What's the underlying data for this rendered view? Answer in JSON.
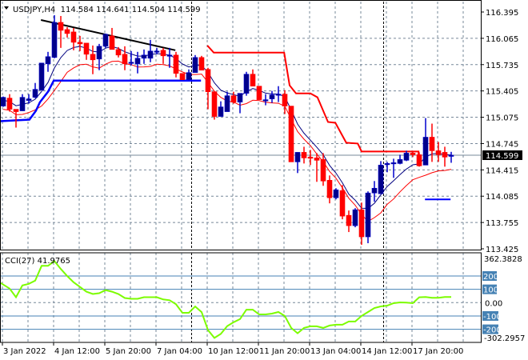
{
  "header": {
    "collapse_icon": "triangle-down-icon",
    "symbol_info": "USDJPY,H4  114.584 114.641 114.504 114.599"
  },
  "current_price": "114.599",
  "colors": {
    "bull": "#00008B",
    "bear": "#FF0000",
    "cci": "#7CFC00",
    "level": "#4682B4",
    "grid": "#778899"
  },
  "chart_data": {
    "type": "candlestick",
    "symbol": "USDJPY",
    "timeframe": "H4",
    "price_ticks": [
      "116.395",
      "116.065",
      "115.735",
      "115.405",
      "115.075",
      "114.745",
      "114.415",
      "114.085",
      "113.755",
      "113.425"
    ],
    "price_range": [
      113.425,
      116.395
    ],
    "time_labels": [
      {
        "label": "3 Jan 2022",
        "index": 0
      },
      {
        "label": "4 Jan 12:00",
        "index": 8
      },
      {
        "label": "5 Jan 20:00",
        "index": 16
      },
      {
        "label": "7 Jan 04:00",
        "index": 24
      },
      {
        "label": "10 Jan 12:00",
        "index": 32
      },
      {
        "label": "11 Jan 20:00",
        "index": 40
      },
      {
        "label": "13 Jan 04:00",
        "index": 48
      },
      {
        "label": "14 Jan 12:00",
        "index": 56
      },
      {
        "label": "17 Jan 20:00",
        "index": 64
      }
    ],
    "session_separators": [
      29,
      59
    ],
    "candles_ohlc": [
      [
        115.215,
        115.335,
        115.205,
        115.325
      ],
      [
        115.315,
        115.365,
        115.145,
        115.175
      ],
      [
        115.175,
        115.175,
        114.945,
        115.145
      ],
      [
        115.155,
        115.365,
        115.155,
        115.325
      ],
      [
        115.285,
        115.365,
        115.245,
        115.305
      ],
      [
        115.325,
        115.505,
        115.315,
        115.425
      ],
      [
        115.415,
        115.755,
        115.415,
        115.755
      ],
      [
        115.745,
        115.895,
        115.645,
        115.835
      ],
      [
        115.825,
        116.355,
        115.815,
        116.265
      ],
      [
        116.265,
        116.345,
        115.945,
        116.165
      ],
      [
        116.175,
        116.205,
        116.075,
        116.125
      ],
      [
        116.145,
        116.195,
        115.915,
        116.015
      ],
      [
        116.015,
        116.095,
        115.905,
        115.995
      ],
      [
        116.005,
        116.005,
        115.795,
        115.865
      ],
      [
        115.865,
        115.975,
        115.615,
        115.795
      ],
      [
        115.805,
        115.995,
        115.665,
        115.965
      ],
      [
        115.965,
        116.125,
        115.945,
        116.115
      ],
      [
        116.095,
        116.195,
        115.925,
        115.925
      ],
      [
        115.925,
        115.955,
        115.825,
        115.855
      ],
      [
        115.865,
        115.965,
        115.665,
        115.745
      ],
      [
        115.755,
        115.905,
        115.725,
        115.765
      ],
      [
        115.745,
        115.895,
        115.625,
        115.815
      ],
      [
        115.815,
        115.925,
        115.745,
        115.855
      ],
      [
        115.815,
        116.045,
        115.765,
        115.905
      ],
      [
        115.9,
        115.945,
        115.865,
        115.905
      ],
      [
        115.915,
        115.945,
        115.745,
        115.845
      ],
      [
        115.85,
        115.945,
        115.695,
        115.855
      ],
      [
        115.855,
        115.895,
        115.575,
        115.625
      ],
      [
        115.625,
        115.625,
        115.545,
        115.545
      ],
      [
        115.545,
        115.675,
        115.535,
        115.635
      ],
      [
        115.635,
        115.855,
        115.635,
        115.825
      ],
      [
        115.825,
        115.845,
        115.665,
        115.665
      ],
      [
        115.675,
        115.695,
        115.175,
        115.395
      ],
      [
        115.395,
        115.395,
        115.045,
        115.085
      ],
      [
        115.085,
        115.275,
        115.085,
        115.205
      ],
      [
        115.145,
        115.395,
        115.145,
        115.345
      ],
      [
        115.345,
        115.395,
        115.245,
        115.265
      ],
      [
        115.265,
        115.375,
        115.125,
        115.375
      ],
      [
        115.375,
        115.645,
        115.345,
        115.615
      ],
      [
        115.615,
        115.675,
        115.465,
        115.465
      ],
      [
        115.465,
        115.465,
        115.295,
        115.295
      ],
      [
        115.285,
        115.365,
        115.225,
        115.295
      ],
      [
        115.305,
        115.405,
        115.255,
        115.355
      ],
      [
        115.355,
        115.465,
        115.265,
        115.365
      ],
      [
        115.365,
        115.415,
        115.115,
        115.215
      ],
      [
        115.215,
        115.215,
        114.515,
        114.515
      ],
      [
        114.515,
        114.635,
        114.375,
        114.635
      ],
      [
        114.635,
        114.705,
        114.495,
        114.565
      ],
      [
        114.575,
        114.665,
        114.475,
        114.565
      ],
      [
        114.565,
        114.625,
        114.265,
        114.535
      ],
      [
        114.545,
        114.625,
        114.215,
        114.275
      ],
      [
        114.285,
        114.345,
        113.995,
        114.065
      ],
      [
        114.065,
        114.185,
        114.045,
        114.165
      ],
      [
        114.155,
        114.225,
        113.795,
        113.835
      ],
      [
        113.845,
        113.905,
        113.635,
        113.715
      ],
      [
        113.715,
        113.935,
        113.695,
        113.915
      ],
      [
        113.915,
        114.005,
        113.475,
        113.575
      ],
      [
        113.575,
        114.145,
        113.495,
        114.125
      ],
      [
        114.125,
        114.275,
        114.015,
        114.185
      ],
      [
        114.115,
        114.525,
        114.115,
        114.475
      ],
      [
        114.485,
        114.515,
        114.385,
        114.495
      ],
      [
        114.495,
        114.555,
        114.315,
        114.505
      ],
      [
        114.495,
        114.605,
        114.485,
        114.545
      ],
      [
        114.535,
        114.655,
        114.525,
        114.625
      ],
      [
        114.625,
        114.655,
        114.575,
        114.605
      ],
      [
        114.605,
        114.635,
        114.455,
        114.465
      ],
      [
        114.475,
        115.065,
        114.475,
        114.825
      ],
      [
        114.825,
        114.995,
        114.515,
        114.655
      ],
      [
        114.655,
        114.765,
        114.515,
        114.605
      ],
      [
        114.635,
        114.705,
        114.455,
        114.575
      ],
      [
        114.584,
        114.641,
        114.504,
        114.599
      ]
    ],
    "red_stop_line": [
      [
        31.9,
        115.975
      ],
      [
        32.9,
        115.885
      ],
      [
        43.9,
        115.885
      ],
      [
        44.75,
        115.475
      ],
      [
        45.75,
        115.375
      ],
      [
        48,
        115.375
      ],
      [
        49.1,
        115.325
      ],
      [
        50.75,
        115.015
      ],
      [
        51.9,
        115.005
      ],
      [
        53.6,
        114.755
      ],
      [
        55.4,
        114.745
      ],
      [
        56,
        114.645
      ],
      [
        64.9,
        114.645
      ],
      [
        64.9,
        114.595
      ]
    ],
    "blue_stop_line": [
      [
        -0.5,
        115.025
      ],
      [
        4.1,
        115.045
      ],
      [
        5.1,
        115.155
      ],
      [
        5.75,
        115.265
      ],
      [
        7,
        115.395
      ],
      [
        7.9,
        115.535
      ],
      [
        30.9,
        115.535
      ]
    ],
    "blue_level_line": [
      [
        65.9,
        114.045
      ],
      [
        69.9,
        114.045
      ]
    ],
    "trendline": [
      [
        5.9,
        116.295
      ],
      [
        26.9,
        115.915
      ]
    ],
    "cci": {
      "label": "CCI(27) 41.9765",
      "period": 27,
      "scale_labels": {
        "max": "362.3828",
        "min": "-302.2957",
        "zero": "0.00",
        "levels": [
          "200",
          "100",
          "-100",
          "-200"
        ]
      },
      "range": [
        -302.2957,
        362.3828
      ],
      "values": [
        147,
        106,
        41,
        129,
        141,
        165,
        276,
        276,
        312,
        253,
        200,
        153,
        118,
        82,
        65,
        71,
        94,
        82,
        65,
        35,
        29,
        29,
        41,
        41,
        41,
        24,
        18,
        -12,
        -76,
        -76,
        -29,
        -71,
        -206,
        -265,
        -235,
        -176,
        -147,
        -124,
        -53,
        -53,
        -88,
        -88,
        -82,
        -70,
        -100,
        -190,
        -230,
        -190,
        -178,
        -178,
        -190,
        -172,
        -166,
        -166,
        -142,
        -142,
        -100,
        -70,
        -40,
        -28,
        -22,
        -4,
        2,
        0,
        -4,
        40,
        42,
        36,
        36,
        42,
        41.9765
      ]
    }
  }
}
